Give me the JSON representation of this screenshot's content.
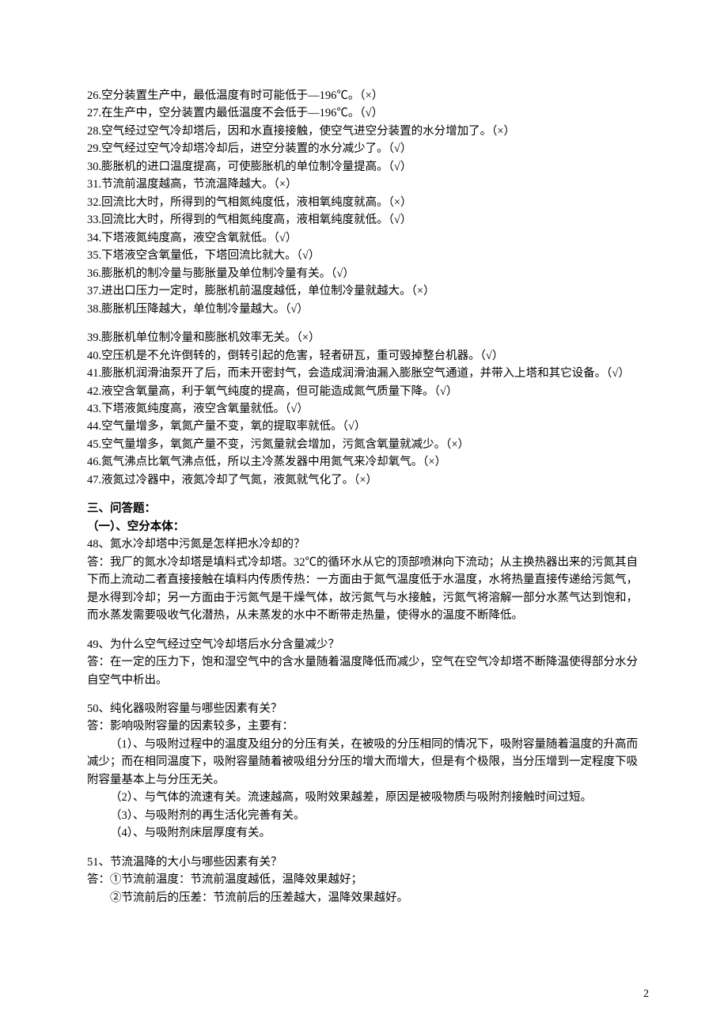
{
  "tf_a": [
    "26.空分装置生产中，最低温度有时可能低于—196℃。（×）",
    "27.在生产中，空分装置内最低温度不会低于—196℃。（√）",
    "28.空气经过空气冷却塔后，因和水直接接触，使空气进空分装置的水分增加了。（×）",
    "29.空气经过空气冷却塔冷却后，进空分装置的水分减少了。（√）",
    "30.膨胀机的进口温度提高，可使膨胀机的单位制冷量提高。（√）",
    "31.节流前温度越高，节流温降越大。（×）",
    "32.回流比大时，所得到的气相氮纯度低，液相氧纯度就高。（×）",
    "33.回流比大时，所得到的气相氮纯度高，液相氧纯度就低。（√）",
    "34.下塔液氮纯度高，液空含氧就低。（√）",
    "35.下塔液空含氧量低，下塔回流比就大。（√）",
    "36.膨胀机的制冷量与膨胀量及单位制冷量有关。（√）",
    "37.进出口压力一定时，膨胀机前温度越低，单位制冷量就越大。（×）",
    "38.膨胀机压降越大，单位制冷量越大。（√）"
  ],
  "tf_b": [
    "39.膨胀机单位制冷量和膨胀机效率无关。（×）",
    "40.空压机是不允许倒转的，倒转引起的危害，轻者研瓦，重可毁掉整台机器。（√）",
    "41.膨胀机润滑油泵开了后，而未开密封气，会造成润滑油漏入膨胀空气通道，并带入上塔和其它设备。（√）",
    "42.液空含氧量高，利于氧气纯度的提高，但可能造成氮气质量下降。（√）",
    "43.下塔液氮纯度高，液空含氧量就低。（√）",
    "44.空气量增多，氧氮产量不变，氧的提取率就低。（√）",
    "45.空气量增多，氧氮产量不变，污氮量就会增加，污氮含氧量就减少。（×）",
    "46.氮气沸点比氧气沸点低，所以主冷蒸发器中用氮气来冷却氧气。（×）",
    "47.液氮过冷器中，液氮冷却了气氮，液氮就气化了。（×）"
  ],
  "section3_title": "三、问答题：",
  "subsection_title": "（一）、空分本体：",
  "qa48": {
    "q": "48、氮水冷却塔中污氮是怎样把水冷却的？",
    "a": "答：我厂的氮水冷却塔是填料式冷却塔。32℃的循环水从它的顶部喷淋向下流动；从主换热器出来的污氮其自下而上流动二者直接接触在填料内传质传热：一方面由于氮气温度低于水温度，水将热量直接传递给污氮气，是水得到冷却；另一方面由于污氮气是干燥气体，故污氮气与水接触，污氮气将溶解一部分水蒸气达到饱和，而水蒸发需要吸收气化潜热，从未蒸发的水中不断带走热量，使得水的温度不断降低。"
  },
  "qa49": {
    "q": "49、为什么空气经过空气冷却塔后水分含量减少？",
    "a": "答：在一定的压力下，饱和湿空气中的含水量随着温度降低而减少，空气在空气冷却塔不断降温使得部分水分自空气中析出。"
  },
  "qa50": {
    "q": "50、纯化器吸附容量与哪些因素有关？",
    "a_lead": "答：影响吸附容量的因素较多，主要有：",
    "a_items": [
      "（1）、与吸附过程中的温度及组分的分压有关，在被吸的分压相同的情况下，吸附容量随着温度的升高而减少；而在相同温度下，吸附容量随着被吸组分分压的增大而增大，但是有个极限，当分压增到一定程度下吸附容量基本上与分压无关。",
      "（2）、与气体的流速有关。流速越高，吸附效果越差，原因是被吸物质与吸附剂接触时间过短。",
      "（3）、与吸附剂的再生活化完善有关。",
      "（4）、与吸附剂床层厚度有关。"
    ]
  },
  "qa51": {
    "q": "51、节流温降的大小与哪些因素有关？",
    "a_lead": "答：①节流前温度：节流前温度越低，温降效果越好；",
    "a_line2": "②节流前后的压差：节流前后的压差越大，温降效果越好。"
  },
  "page_number": "2"
}
